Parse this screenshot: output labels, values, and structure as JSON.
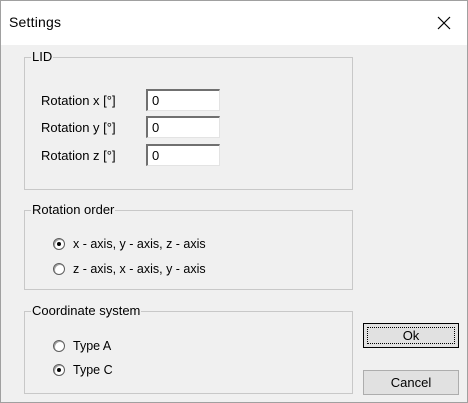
{
  "window": {
    "title": "Settings"
  },
  "lid": {
    "group_label": "LID",
    "fields": [
      {
        "label": "Rotation x [°]",
        "value": "0"
      },
      {
        "label": "Rotation y [°]",
        "value": "0"
      },
      {
        "label": "Rotation z [°]",
        "value": "0"
      }
    ]
  },
  "rotation_order": {
    "group_label": "Rotation order",
    "options": [
      {
        "label": "x - axis, y - axis, z - axis",
        "checked": true
      },
      {
        "label": "z - axis, x - axis, y - axis",
        "checked": false
      }
    ]
  },
  "coordinate_system": {
    "group_label": "Coordinate system",
    "options": [
      {
        "label": "Type A",
        "checked": false
      },
      {
        "label": "Type C",
        "checked": true
      }
    ]
  },
  "buttons": {
    "ok_label": "Ok",
    "cancel_label": "Cancel"
  },
  "icons": {
    "close": "close-icon"
  }
}
